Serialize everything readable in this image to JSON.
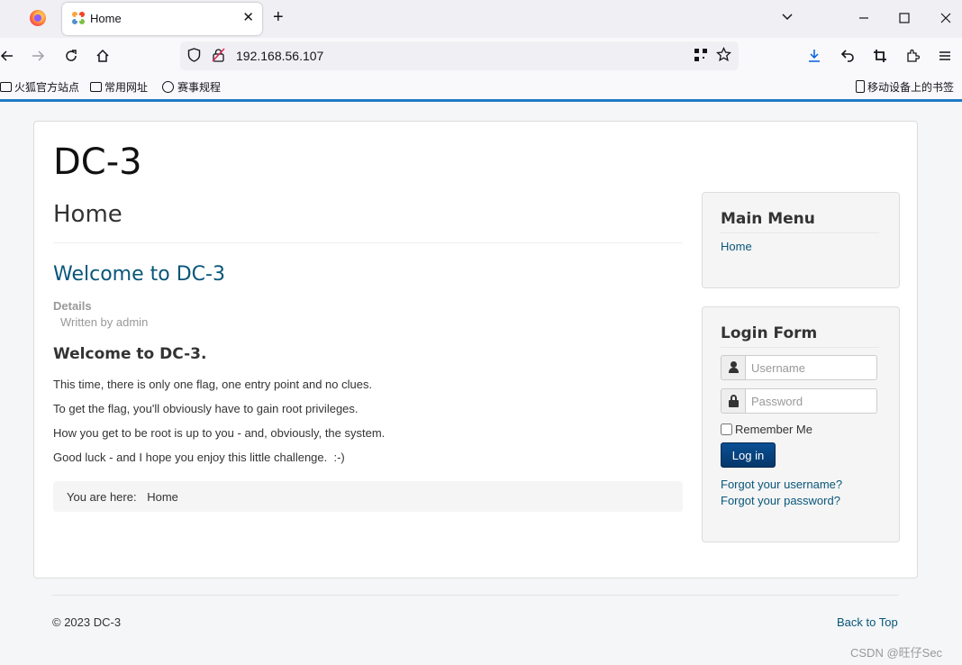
{
  "browser": {
    "tab_title": "Home",
    "tab_close": "✕",
    "new_tab": "+",
    "url": "192.168.56.107",
    "bookmarks": [
      {
        "label": "火狐官方站点"
      },
      {
        "label": "常用网址"
      },
      {
        "label": "赛事规程"
      }
    ],
    "mobile_bookmarks": "移动设备上的书签"
  },
  "site": {
    "title": "DC-3",
    "page_heading": "Home",
    "article": {
      "title": "Welcome to DC-3",
      "details_label": "Details",
      "written_by": "Written by admin",
      "subheading": "Welcome to DC-3.",
      "paragraphs": [
        "This time, there is only one flag, one entry point and no clues.",
        "To get the flag, you'll obviously have to gain root privileges.",
        "How you get to be root is up to you - and, obviously, the system.",
        "Good luck - and I hope you enjoy this little challenge.  :-)"
      ]
    },
    "breadcrumb": {
      "label": "You are here:",
      "current": "Home"
    },
    "main_menu": {
      "title": "Main Menu",
      "items": [
        {
          "label": "Home"
        }
      ]
    },
    "login_form": {
      "title": "Login Form",
      "username_placeholder": "Username",
      "password_placeholder": "Password",
      "remember_label": "Remember Me",
      "login_button": "Log in",
      "forgot_username": "Forgot your username?",
      "forgot_password": "Forgot your password?"
    },
    "footer": {
      "copyright": "© 2023 DC-3",
      "back_to_top": "Back to Top"
    }
  },
  "watermark": "CSDN @旺仔Sec",
  "colors": {
    "accent_blue": "#1f7ac3",
    "link": "#08567a",
    "button": "#05376a"
  }
}
